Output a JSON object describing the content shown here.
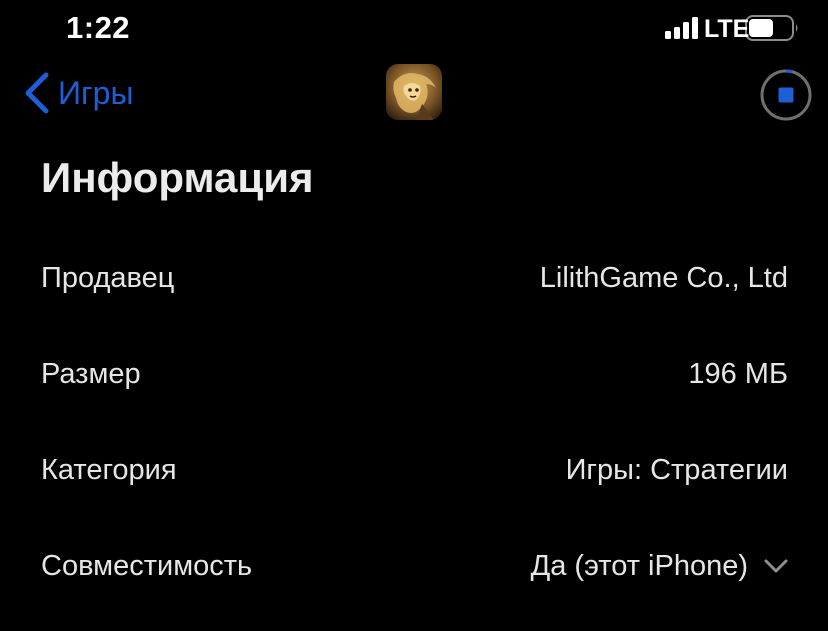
{
  "status_bar": {
    "time": "1:22",
    "network": "LTE",
    "signal_icon": "signal-bars-icon",
    "battery_icon": "battery-icon"
  },
  "nav": {
    "back_label": "Игры",
    "back_icon": "chevron-left-icon",
    "app_icon": "app-icon",
    "download_icon": "stop-download-icon"
  },
  "section": {
    "title": "Информация"
  },
  "info": [
    {
      "label": "Продавец",
      "value": "LilithGame Co., Ltd"
    },
    {
      "label": "Размер",
      "value": "196 МБ"
    },
    {
      "label": "Категория",
      "value": "Игры: Стратегии"
    },
    {
      "label": "Совместимость",
      "value": "Да (этот iPhone)"
    }
  ],
  "colors": {
    "background": "#000000",
    "accent": "#1e5fd6",
    "text": "#e6e6e6"
  }
}
